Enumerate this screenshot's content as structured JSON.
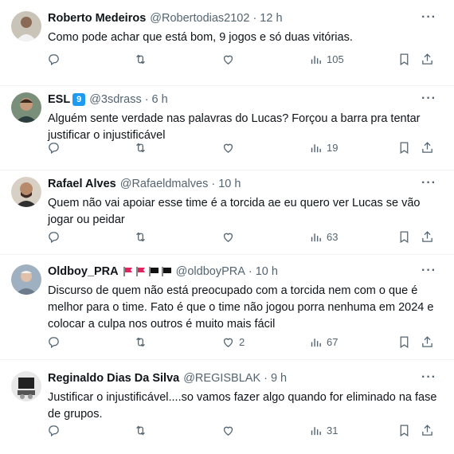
{
  "tweets": [
    {
      "name": "Roberto Medeiros",
      "handle": "@Robertodias2102",
      "time": "12 h",
      "text": "Como pode achar que está bom, 9 jogos e só duas vitórias.",
      "replies": "",
      "retweets": "",
      "likes": "",
      "views": "105"
    },
    {
      "name": "ESL",
      "badge": "9",
      "handle": "@3sdrass",
      "time": "6 h",
      "text": "Alguém sente verdade nas palavras do Lucas? Forçou a barra pra tentar justificar o injustificável",
      "replies": "",
      "retweets": "",
      "likes": "",
      "views": "19"
    },
    {
      "name": "Rafael Alves",
      "handle": "@Rafaeldmalves",
      "time": "10 h",
      "text": "Quem não vai apoiar esse time é a torcida ae eu quero ver Lucas se vão jogar ou peidar",
      "replies": "",
      "retweets": "",
      "likes": "",
      "views": "63"
    },
    {
      "name": "Oldboy_PRA",
      "handle": "@oldboyPRA",
      "time": "10 h",
      "text": "Discurso de quem não está preocupado com a torcida nem com o que é melhor para o time. Fato é que o time não jogou porra nenhuma em 2024 e colocar a culpa nos outros é muito mais fácil",
      "replies": "",
      "retweets": "",
      "likes": "2",
      "views": "67"
    },
    {
      "name": "Reginaldo Dias Da Silva",
      "handle": "@REGISBLAK",
      "time": "9 h",
      "text": "Justificar o injustificável....so vamos fazer algo quando for eliminado na fase de grupos.",
      "replies": "",
      "retweets": "",
      "likes": "",
      "views": "31"
    }
  ],
  "separator": "·",
  "more_glyph": "···",
  "colors": {
    "text": "#0f1419",
    "muted": "#536471",
    "verified": "#1d9bf0",
    "divider": "#eff3f4"
  },
  "icons": [
    "reply-icon",
    "retweet-icon",
    "like-icon",
    "views-icon",
    "bookmark-icon",
    "share-icon",
    "more-icon",
    "red-flag-icon",
    "black-flag-icon"
  ]
}
